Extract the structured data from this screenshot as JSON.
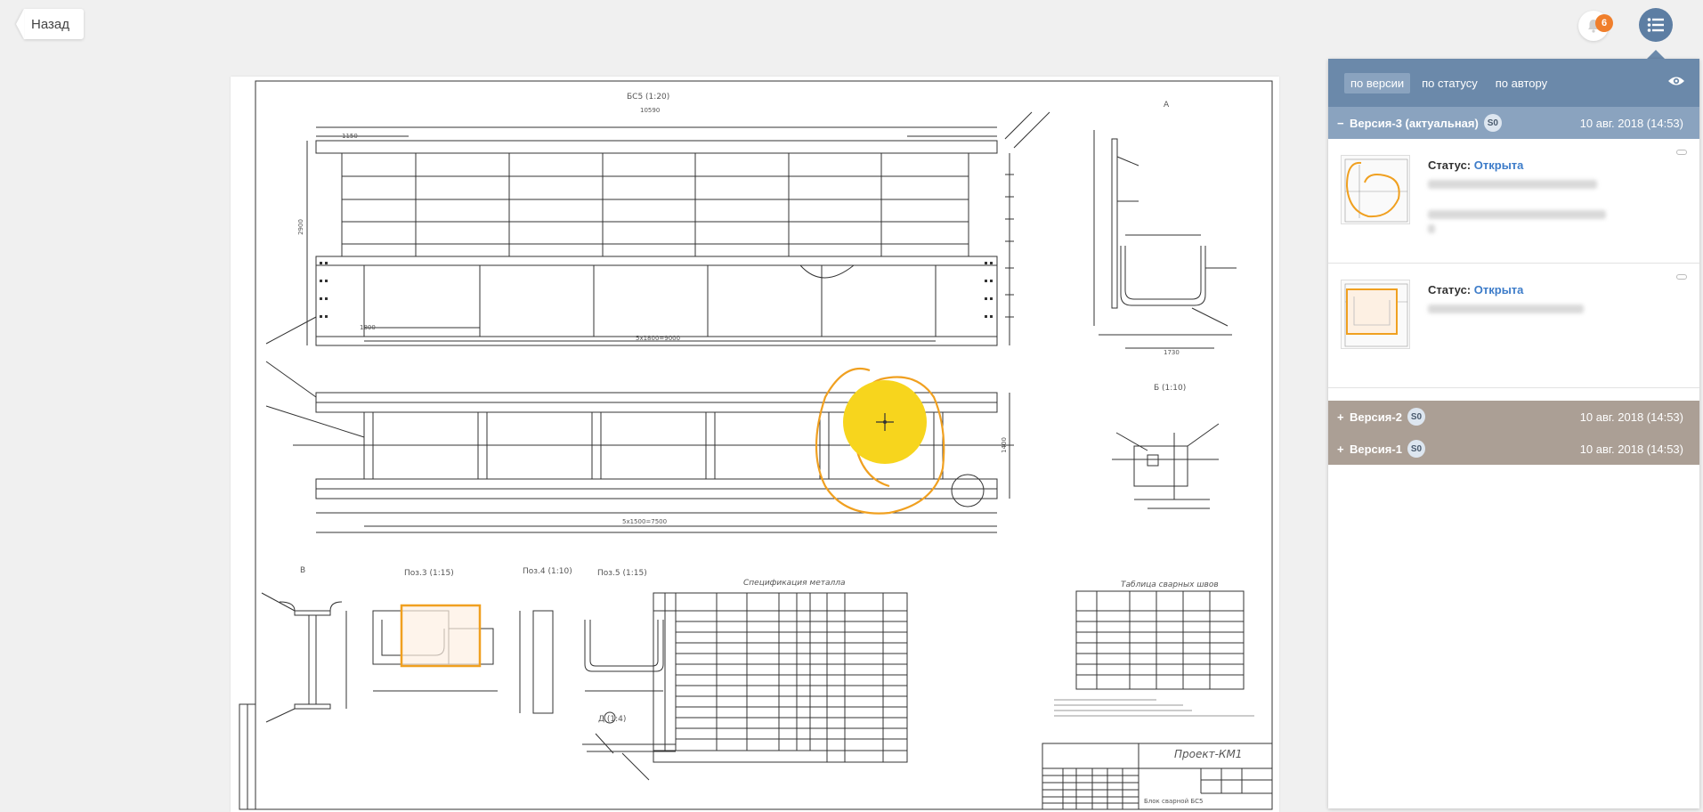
{
  "header": {
    "back_label": "Назад",
    "notifications_count": "6"
  },
  "drawing": {
    "main_title": "БС5 (1:20)",
    "view_a": "А",
    "view_b": "Б (1:10)",
    "view_v": "В",
    "pos3": "Поз.3 (1:15)",
    "pos4": "Поз.4 (1:10)",
    "pos5": "Поз.5 (1:15)",
    "spec_title": "Спецификация металла",
    "welds_title": "Таблица сварных швов",
    "stamp_title": "Проект-КМ1",
    "stamp_sub": "Блок сварной БС5",
    "dim_total": "10590",
    "dim_5x1800": "5х1800=9000",
    "dim_5x1500": "5х1500=7500",
    "dim_1800": "1800",
    "dim_1150": "1150",
    "dim_2900": "2900",
    "dim_1400": "1400",
    "dim_1730": "1730",
    "view_d": "Д (1:4)"
  },
  "panel": {
    "tabs": [
      "по версии",
      "по статусу",
      "по автору"
    ],
    "versions": [
      {
        "sign": "−",
        "label": "Версия-3 (актуальная)",
        "badge": "S0",
        "date": "10 авг. 2018 (14:53)"
      },
      {
        "sign": "+",
        "label": "Версия-2",
        "badge": "S0",
        "date": "10 авг. 2018 (14:53)"
      },
      {
        "sign": "+",
        "label": "Версия-1",
        "badge": "S0",
        "date": "10 авг. 2018 (14:53)"
      }
    ],
    "items": [
      {
        "status_label": "Статус:",
        "status_value": "Открыта"
      },
      {
        "status_label": "Статус:",
        "status_value": "Открыта"
      }
    ]
  },
  "colors": {
    "panel_header": "#6b89aa",
    "version_current": "#8aa3bf",
    "version_old": "#ab9f95",
    "annotation_orange": "#f0a020",
    "cursor_yellow": "#f7d51d",
    "link_blue": "#3d7cc9"
  },
  "icons": {
    "back": "chevron-left-icon",
    "bell": "bell-icon",
    "menu": "list-menu-icon",
    "eye": "eye-icon"
  }
}
